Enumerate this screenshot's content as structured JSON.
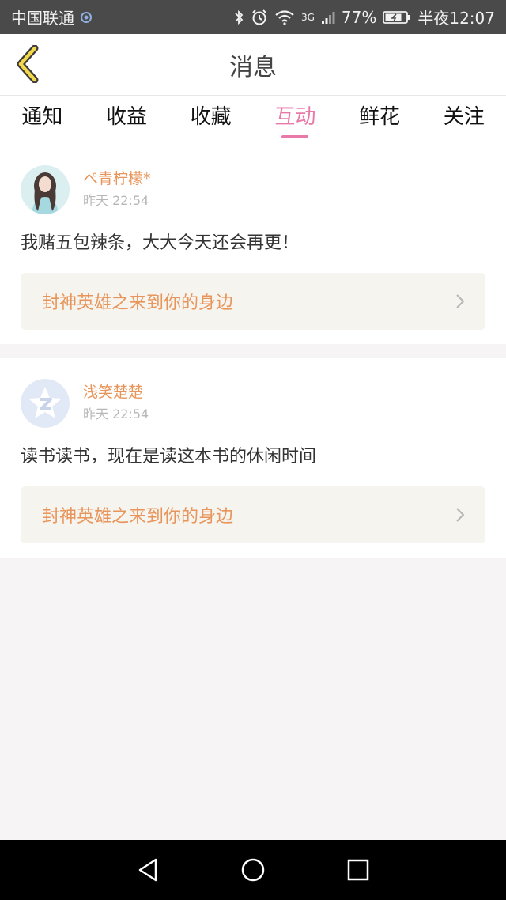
{
  "status_bar": {
    "carrier": "中国联通",
    "network_small": "3G",
    "battery": "77%",
    "time": "半夜12:07"
  },
  "header": {
    "title": "消息"
  },
  "tabs": [
    {
      "label": "通知",
      "active": false
    },
    {
      "label": "收益",
      "active": false
    },
    {
      "label": "收藏",
      "active": false
    },
    {
      "label": "互动",
      "active": true
    },
    {
      "label": "鲜花",
      "active": false
    },
    {
      "label": "关注",
      "active": false
    }
  ],
  "messages": [
    {
      "user": "ぺ青柠檬*",
      "time": "昨天 22:54",
      "text": "我赌五包辣条，大大今天还会再更！",
      "book": "封神英雄之来到你的身边",
      "avatar_icon": "girl-photo-icon"
    },
    {
      "user": "浅笑楚楚",
      "time": "昨天 22:54",
      "text": "读书读书，现在是读这本书的休闲时间",
      "book": "封神英雄之来到你的身边",
      "avatar_icon": "default-z-avatar-icon"
    }
  ],
  "colors": {
    "accent_pink": "#e879a8",
    "accent_orange": "#e8955b",
    "statusbar": "#4a4a4a"
  }
}
